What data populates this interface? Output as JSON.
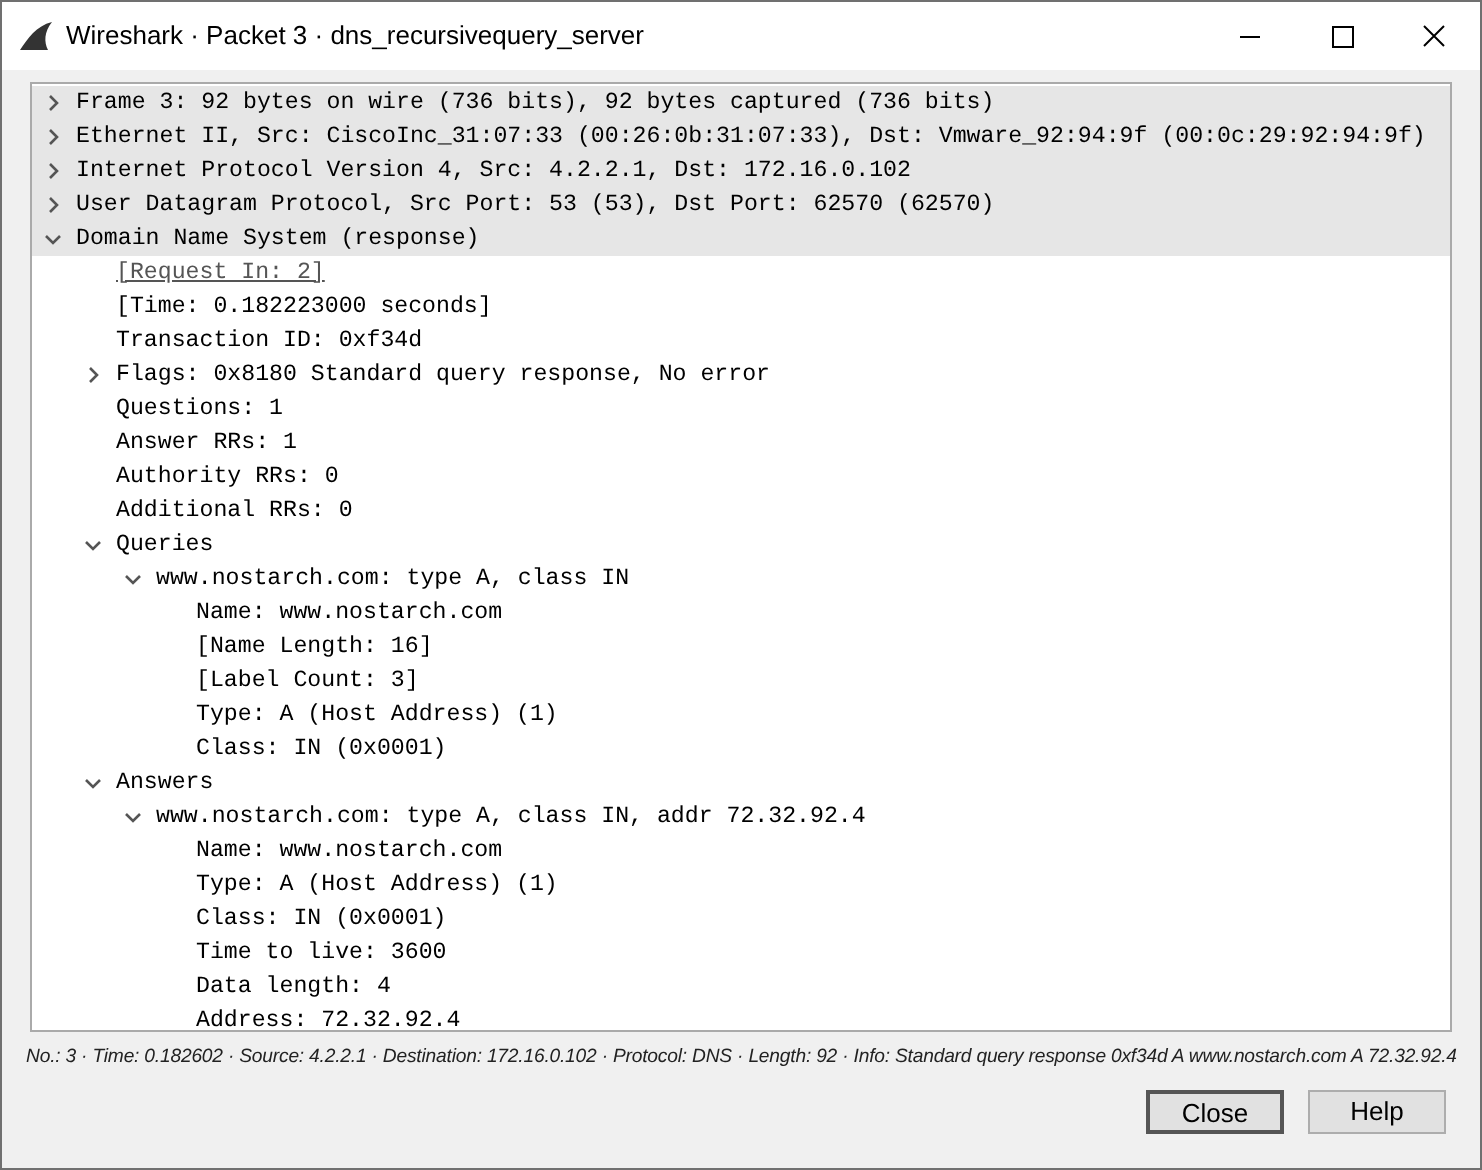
{
  "window": {
    "title": "Wireshark · Packet 3 · dns_recursivequery_server"
  },
  "tree": [
    {
      "label": "Frame 3: 92 bytes on wire (736 bits), 92 bytes captured (736 bits)",
      "expanded": false
    },
    {
      "label": "Ethernet II, Src: CiscoInc_31:07:33 (00:26:0b:31:07:33), Dst: Vmware_92:94:9f (00:0c:29:92:94:9f)",
      "expanded": false
    },
    {
      "label": "Internet Protocol Version 4, Src: 4.2.2.1, Dst: 172.16.0.102",
      "expanded": false
    },
    {
      "label": "User Datagram Protocol, Src Port: 53 (53), Dst Port: 62570 (62570)",
      "expanded": false
    },
    {
      "label": "Domain Name System (response)",
      "expanded": true,
      "children": [
        {
          "label": "[Request In: 2]",
          "kind": "link"
        },
        {
          "label": "[Time: 0.182223000 seconds]"
        },
        {
          "label": "Transaction ID: 0xf34d"
        },
        {
          "label": "Flags: 0x8180 Standard query response, No error",
          "expanded": false
        },
        {
          "label": "Questions: 1"
        },
        {
          "label": "Answer RRs: 1"
        },
        {
          "label": "Authority RRs: 0"
        },
        {
          "label": "Additional RRs: 0"
        },
        {
          "label": "Queries",
          "expanded": true,
          "children": [
            {
              "label": "www.nostarch.com: type A, class IN",
              "expanded": true,
              "children": [
                {
                  "label": "Name: www.nostarch.com"
                },
                {
                  "label": "[Name Length: 16]"
                },
                {
                  "label": "[Label Count: 3]"
                },
                {
                  "label": "Type: A (Host Address) (1)"
                },
                {
                  "label": "Class: IN (0x0001)"
                }
              ]
            }
          ]
        },
        {
          "label": "Answers",
          "expanded": true,
          "children": [
            {
              "label": "www.nostarch.com: type A, class IN, addr 72.32.92.4",
              "expanded": true,
              "children": [
                {
                  "label": "Name: www.nostarch.com"
                },
                {
                  "label": "Type: A (Host Address) (1)"
                },
                {
                  "label": "Class: IN (0x0001)"
                },
                {
                  "label": "Time to live: 3600"
                },
                {
                  "label": "Data length: 4"
                },
                {
                  "label": "Address: 72.32.92.4"
                }
              ]
            }
          ]
        }
      ]
    }
  ],
  "status_bar": "No.: 3 · Time: 0.182602 · Source: 4.2.2.1 · Destination: 172.16.0.102 · Protocol: DNS · Length: 92 · Info: Standard query response 0xf34d A www.nostarch.com A 72.32.92.4",
  "buttons": [
    {
      "label": "Close",
      "default": true
    },
    {
      "label": "Help",
      "default": false
    }
  ]
}
